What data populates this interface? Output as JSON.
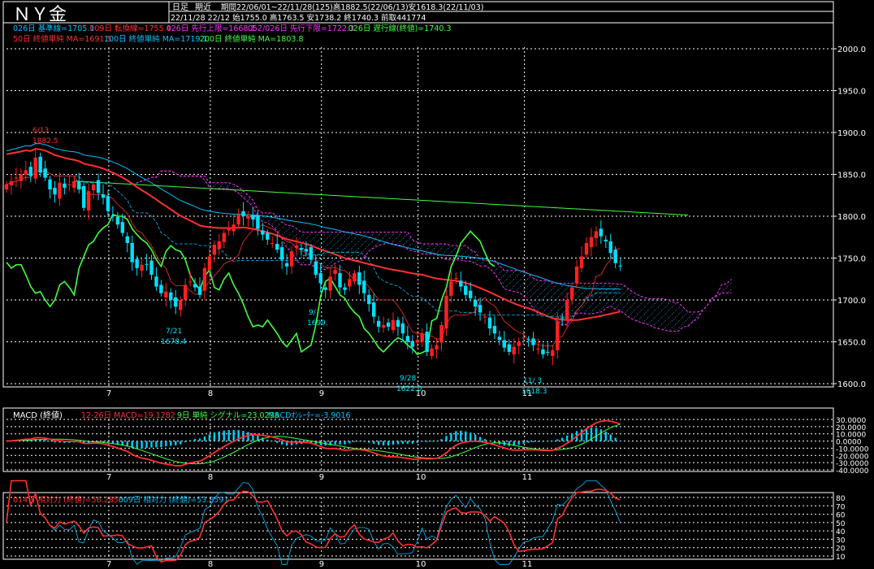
{
  "header": {
    "title": "ＮＹ金",
    "period_type": "日足",
    "period_range": "期近",
    "info1": "期間22/06/01~22/11/28(125)高1882.5(22/06/13)安1618.3(22/11/03)",
    "info2": "22/11/28 22/12 始1755.0 高1763.5 安1738.2 終1740.3 前取441774"
  },
  "legend_main": {
    "row1": [
      {
        "text": "026日 基準線=1705.1",
        "color": "#00c0ff"
      },
      {
        "text": "009日 転換線=1755.4",
        "color": "#ff3030"
      },
      {
        "text": "026日 先行上限=1668.1",
        "color": "#ff30ff"
      },
      {
        "text": "052/026日 先行下限=1722.3",
        "color": "#ff30ff"
      },
      {
        "text": "026日 遅行線(終値)=1740.3",
        "color": "#40ff40"
      }
    ],
    "row2": [
      {
        "text": "50日 終値単純 MA=1691.5",
        "color": "#ff3030"
      },
      {
        "text": "100日 終値単純 MA=1719.1",
        "color": "#00c0ff"
      },
      {
        "text": "200日 終値単純 MA=1803.8",
        "color": "#40ff40"
      }
    ]
  },
  "price_axis": {
    "ticks": [
      "2000.0",
      "1950.0",
      "1900.0",
      "1850.0",
      "1800.0",
      "1750.0",
      "1700.0",
      "1650.0",
      "1600.0"
    ]
  },
  "month_labels": [
    "7",
    "8",
    "9",
    "10",
    "11"
  ],
  "annotations": [
    {
      "text": "6/13"
    },
    {
      "text": "1882.5"
    },
    {
      "text": "7/21"
    },
    {
      "text": "1678.4"
    },
    {
      "text": "9/28"
    },
    {
      "text": "1622.0"
    },
    {
      "text": "11/ 3"
    },
    {
      "text": "1618.3"
    },
    {
      "text": "9/"
    },
    {
      "text": "1699."
    }
  ],
  "macd": {
    "title": "MACD (終値)",
    "legend": [
      {
        "text": "12-26日 MACD=19.1282",
        "color": "#ff3030"
      },
      {
        "text": "9日 単純 シグナル=23.0298",
        "color": "#40ff40"
      },
      {
        "text": "MACDｵｼﾚｰﾀｰ=-3.9016",
        "color": "#00c0ff"
      }
    ],
    "ticks": [
      "30.0000",
      "20.0000",
      "10.0000",
      "0.0000",
      "-10.0000",
      "-20.0000",
      "-30.0000",
      "-40.0000"
    ]
  },
  "rsi": {
    "legend": [
      {
        "text": "014日 相対力 (終値)=56.2853",
        "color": "#ff3030"
      },
      {
        "text": "009日 相対力 (終値)=53.8591",
        "color": "#00c0ff"
      }
    ],
    "ticks": [
      "80",
      "70",
      "60",
      "50",
      "40",
      "30",
      "20",
      "10"
    ]
  },
  "colors": {
    "up_candle": "#ff2020",
    "down_candle": "#00e0ff",
    "kumo": "#ff30ff",
    "kumo_fill": "#40c0ff",
    "grid": "#ffffff"
  },
  "chart_data": [
    {
      "type": "candlestick",
      "title": "ＮＹ金",
      "ylim": [
        1600,
        2000
      ],
      "x_range": [
        "22/06/01",
        "22/11/28"
      ],
      "summary": {
        "high": 1882.5,
        "high_date": "22/06/13",
        "low": 1618.3,
        "low_date": "22/11/03",
        "bars": 125
      },
      "last_bar": {
        "date": "22/11/28",
        "open": 1755.0,
        "high": 1763.5,
        "low": 1738.2,
        "close": 1740.3
      },
      "close_series": [
        1838,
        1842,
        1846,
        1850,
        1855,
        1848,
        1870,
        1852,
        1846,
        1832,
        1826,
        1840,
        1834,
        1838,
        1842,
        1832,
        1810,
        1830,
        1838,
        1828,
        1822,
        1806,
        1800,
        1790,
        1780,
        1768,
        1745,
        1738,
        1742,
        1742,
        1730,
        1716,
        1708,
        1710,
        1700,
        1692,
        1700,
        1718,
        1722,
        1715,
        1706,
        1738,
        1752,
        1766,
        1770,
        1780,
        1786,
        1790,
        1802,
        1800,
        1800,
        1796,
        1785,
        1778,
        1772,
        1768,
        1760,
        1748,
        1740,
        1758,
        1765,
        1760,
        1758,
        1748,
        1730,
        1720,
        1712,
        1728,
        1736,
        1715,
        1712,
        1725,
        1732,
        1718,
        1708,
        1695,
        1680,
        1668,
        1670,
        1668,
        1676,
        1668,
        1660,
        1650,
        1644,
        1652,
        1660,
        1638,
        1642,
        1646,
        1670,
        1705,
        1722,
        1726,
        1716,
        1706,
        1702,
        1692,
        1685,
        1680,
        1666,
        1660,
        1652,
        1643,
        1638,
        1644,
        1650,
        1655,
        1652,
        1646,
        1642,
        1635,
        1637,
        1640,
        1675,
        1678,
        1700,
        1715,
        1740,
        1752,
        1768,
        1775,
        1782,
        1776,
        1770,
        1756,
        1744,
        1740
      ],
      "series": [
        {
          "name": "026日 基準線",
          "last": 1705.1
        },
        {
          "name": "009日 転換線",
          "last": 1755.4
        },
        {
          "name": "026日 先行上限",
          "last": 1668.1
        },
        {
          "name": "052/026日 先行下限",
          "last": 1722.3
        },
        {
          "name": "026日 遅行線(終値)",
          "last": 1740.3
        },
        {
          "name": "50日 終値単純 MA",
          "last": 1691.5
        },
        {
          "name": "100日 終値単純 MA",
          "last": 1719.1
        },
        {
          "name": "200日 終値単純 MA",
          "last": 1803.8
        }
      ],
      "x_tick_labels": [
        "7",
        "8",
        "9",
        "10",
        "11"
      ]
    },
    {
      "type": "line",
      "title": "MACD (終値)",
      "ylim": [
        -40,
        30
      ],
      "series": [
        {
          "name": "12-26日 MACD",
          "last": 19.1282
        },
        {
          "name": "9日 単純 シグナル",
          "last": 23.0298
        },
        {
          "name": "MACDｵｼﾚｰﾀｰ",
          "last": -3.9016
        }
      ]
    },
    {
      "type": "line",
      "title": "",
      "ylim": [
        10,
        80
      ],
      "series": [
        {
          "name": "014日 相対力 (終値)",
          "last": 56.2853
        },
        {
          "name": "009日 相対力 (終値)",
          "last": 53.8591
        }
      ]
    }
  ]
}
